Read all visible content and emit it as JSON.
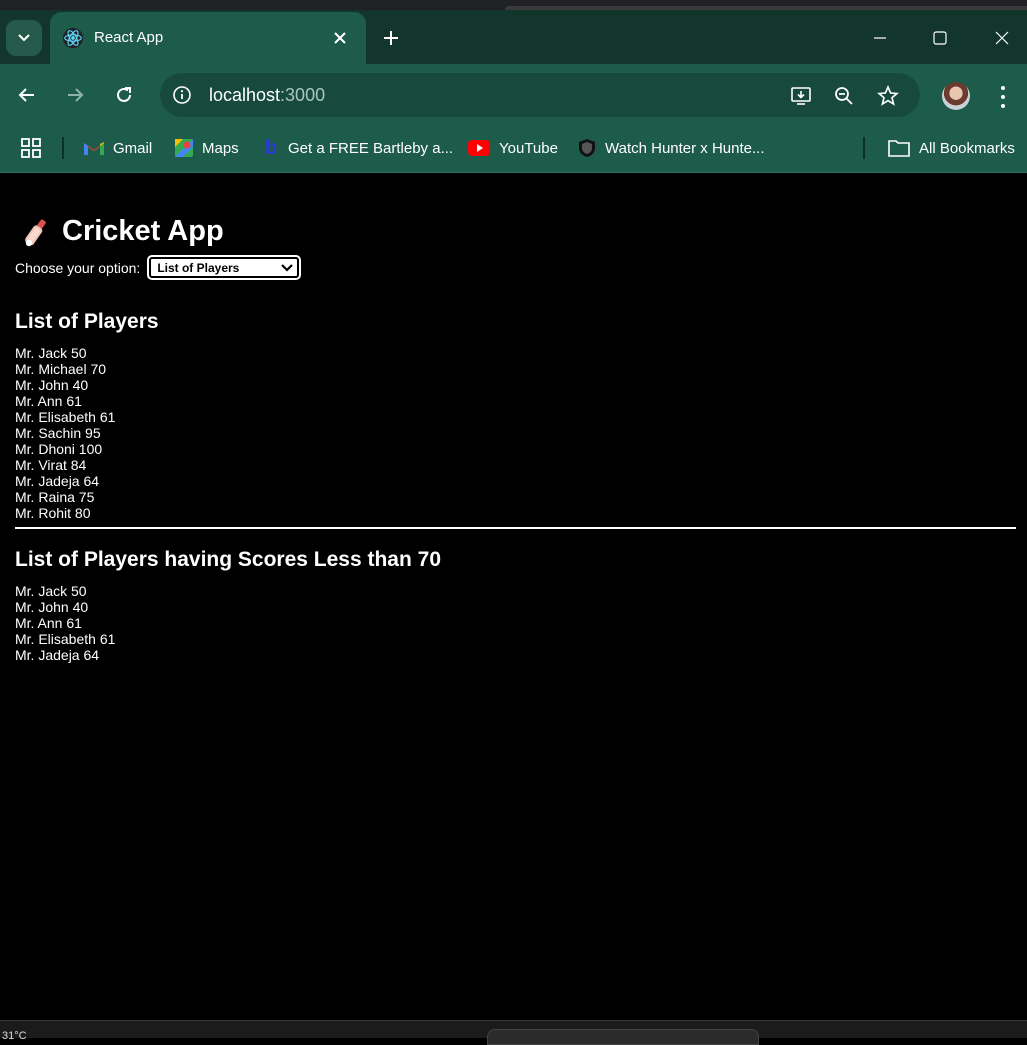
{
  "browser": {
    "tab": {
      "title": "React App"
    },
    "address": {
      "host": "localhost",
      "port": ":3000"
    },
    "bookmarks": [
      {
        "label": "Gmail",
        "icon": "gmail-icon"
      },
      {
        "label": "Maps",
        "icon": "maps-icon"
      },
      {
        "label": "Get a FREE Bartleby a...",
        "icon": "bartleby-icon"
      },
      {
        "label": "YouTube",
        "icon": "youtube-icon"
      },
      {
        "label": "Watch Hunter x Hunte...",
        "icon": "shield-icon"
      }
    ],
    "all_bookmarks_label": "All Bookmarks",
    "colors": {
      "frame": "#13362c",
      "toolbar": "#1d5b4a",
      "omnibox": "#174a3d"
    }
  },
  "app": {
    "title": "Cricket App",
    "option_label": "Choose your option:",
    "select": {
      "selected": "List of Players"
    },
    "all_players": {
      "heading": "List of Players",
      "items": [
        "Mr. Jack 50",
        "Mr. Michael 70",
        "Mr. John 40",
        "Mr. Ann 61",
        "Mr. Elisabeth 61",
        "Mr. Sachin 95",
        "Mr. Dhoni 100",
        "Mr. Virat 84",
        "Mr. Jadeja 64",
        "Mr. Raina 75",
        "Mr. Rohit 80"
      ]
    },
    "low_scorers": {
      "heading": "List of Players having Scores Less than 70",
      "items": [
        "Mr. Jack 50",
        "Mr. John 40",
        "Mr. Ann 61",
        "Mr. Elisabeth 61",
        "Mr. Jadeja 64"
      ]
    }
  },
  "taskbar": {
    "weather": "31°C"
  }
}
